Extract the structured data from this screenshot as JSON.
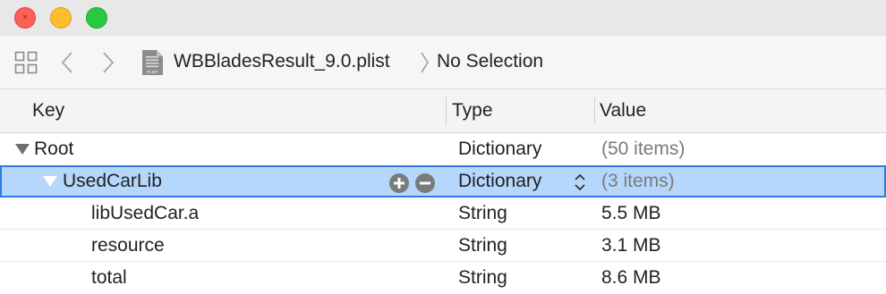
{
  "window": {
    "traffic_lights": {
      "close": "close-button",
      "minimize": "minimize-button",
      "zoom": "zoom-button"
    },
    "close_glyph": "×"
  },
  "pathbar": {
    "filename": "WBBladesResult_9.0.plist",
    "file_icon_label": "PLIST",
    "selection": "No Selection"
  },
  "columns": {
    "key": "Key",
    "type": "Type",
    "value": "Value"
  },
  "rows": [
    {
      "key": "Root",
      "type": "Dictionary",
      "value": "(50 items)",
      "expanded": true,
      "value_dim": true
    },
    {
      "key": "UsedCarLib",
      "type": "Dictionary",
      "value": "(3 items)",
      "expanded": true,
      "selected": true,
      "value_dim": true
    },
    {
      "key": "libUsedCar.a",
      "type": "String",
      "value": "5.5 MB"
    },
    {
      "key": "resource",
      "type": "String",
      "value": "3.1 MB"
    },
    {
      "key": "total",
      "type": "String",
      "value": "8.6 MB"
    }
  ],
  "colors": {
    "selection_fill": "#b4d7fb",
    "selection_border": "#2c7ce0",
    "close": "#fe5f57",
    "minimize": "#febc2e",
    "zoom": "#28c840"
  }
}
